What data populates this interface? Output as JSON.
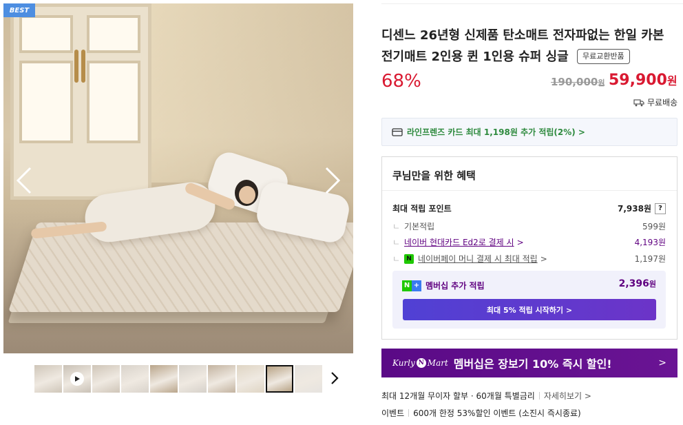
{
  "gallery": {
    "badge": "BEST",
    "thumbnails": [
      {
        "type": "image",
        "tone": "#cfc6b9"
      },
      {
        "type": "video",
        "tone": "#c9c1b6"
      },
      {
        "type": "image",
        "tone": "#cfc5b8"
      },
      {
        "type": "image",
        "tone": "#d9d3cb"
      },
      {
        "type": "image",
        "tone": "#b9a58b"
      },
      {
        "type": "image",
        "tone": "#d6d1ca"
      },
      {
        "type": "image",
        "tone": "#c3b3a0"
      },
      {
        "type": "image",
        "tone": "#dfd5c4"
      },
      {
        "type": "image",
        "tone": "#b29c7c",
        "selected": true
      },
      {
        "type": "image",
        "tone": "#e6e3df"
      }
    ]
  },
  "product": {
    "title": "디센느 26년형 신제품 탄소매트 전자파없는 한일 카본 전기매트 2인용 퀸 1인용 슈퍼 싱글",
    "exchange_badge": "무료교환반품",
    "discount_rate": "68%",
    "original_price": "190,000",
    "original_unit": "원",
    "sale_price": "59,900",
    "sale_unit": "원",
    "shipping": "무료배송"
  },
  "card_promo": {
    "text": "라인프렌즈 카드 최대 1,198원 추가 적립(2%) >"
  },
  "benefits": {
    "title": "쿠님만을 위한 혜택",
    "max_points_label": "최대 적립 포인트",
    "max_points_value": "7,938원",
    "help": "?",
    "basic_label": "기본적립",
    "basic_value": "599원",
    "naver_card_label": "네이버 현대카드 Ed2로 결제 시",
    "naver_card_value": "4,193원",
    "npay_label": "네이버페이 머니 결제 시 최대 적립",
    "npay_value": "1,197원",
    "npay_icon_text": "N",
    "corner_mark": "ㄴ",
    "chevron": ">",
    "membership_label": "멤버십 추가 적립",
    "membership_value": "2,396",
    "membership_unit": "원",
    "membership_button": "최대 5% 적립 시작하기 >",
    "np_badge_n": "N",
    "np_badge_plus": "+"
  },
  "kurly_banner": {
    "logo_left": "Kurly",
    "logo_n": "N",
    "logo_right": "Mart",
    "text": "멤버십은 장보기 10% 즉시 할인!",
    "arrow": ">"
  },
  "installment": {
    "text": "최대 12개월 무이자 할부 · 60개월 특별금리",
    "more": "자세히보기 >"
  },
  "event": {
    "label": "이벤트",
    "text": "600개 한정 53%할인 이벤트 (소진시 즉시종료)"
  },
  "colors": {
    "discount": "#d91931",
    "card_promo_text": "#2e8a3e",
    "purple": "#5f0080",
    "best_badge": "#4d8ee1"
  }
}
